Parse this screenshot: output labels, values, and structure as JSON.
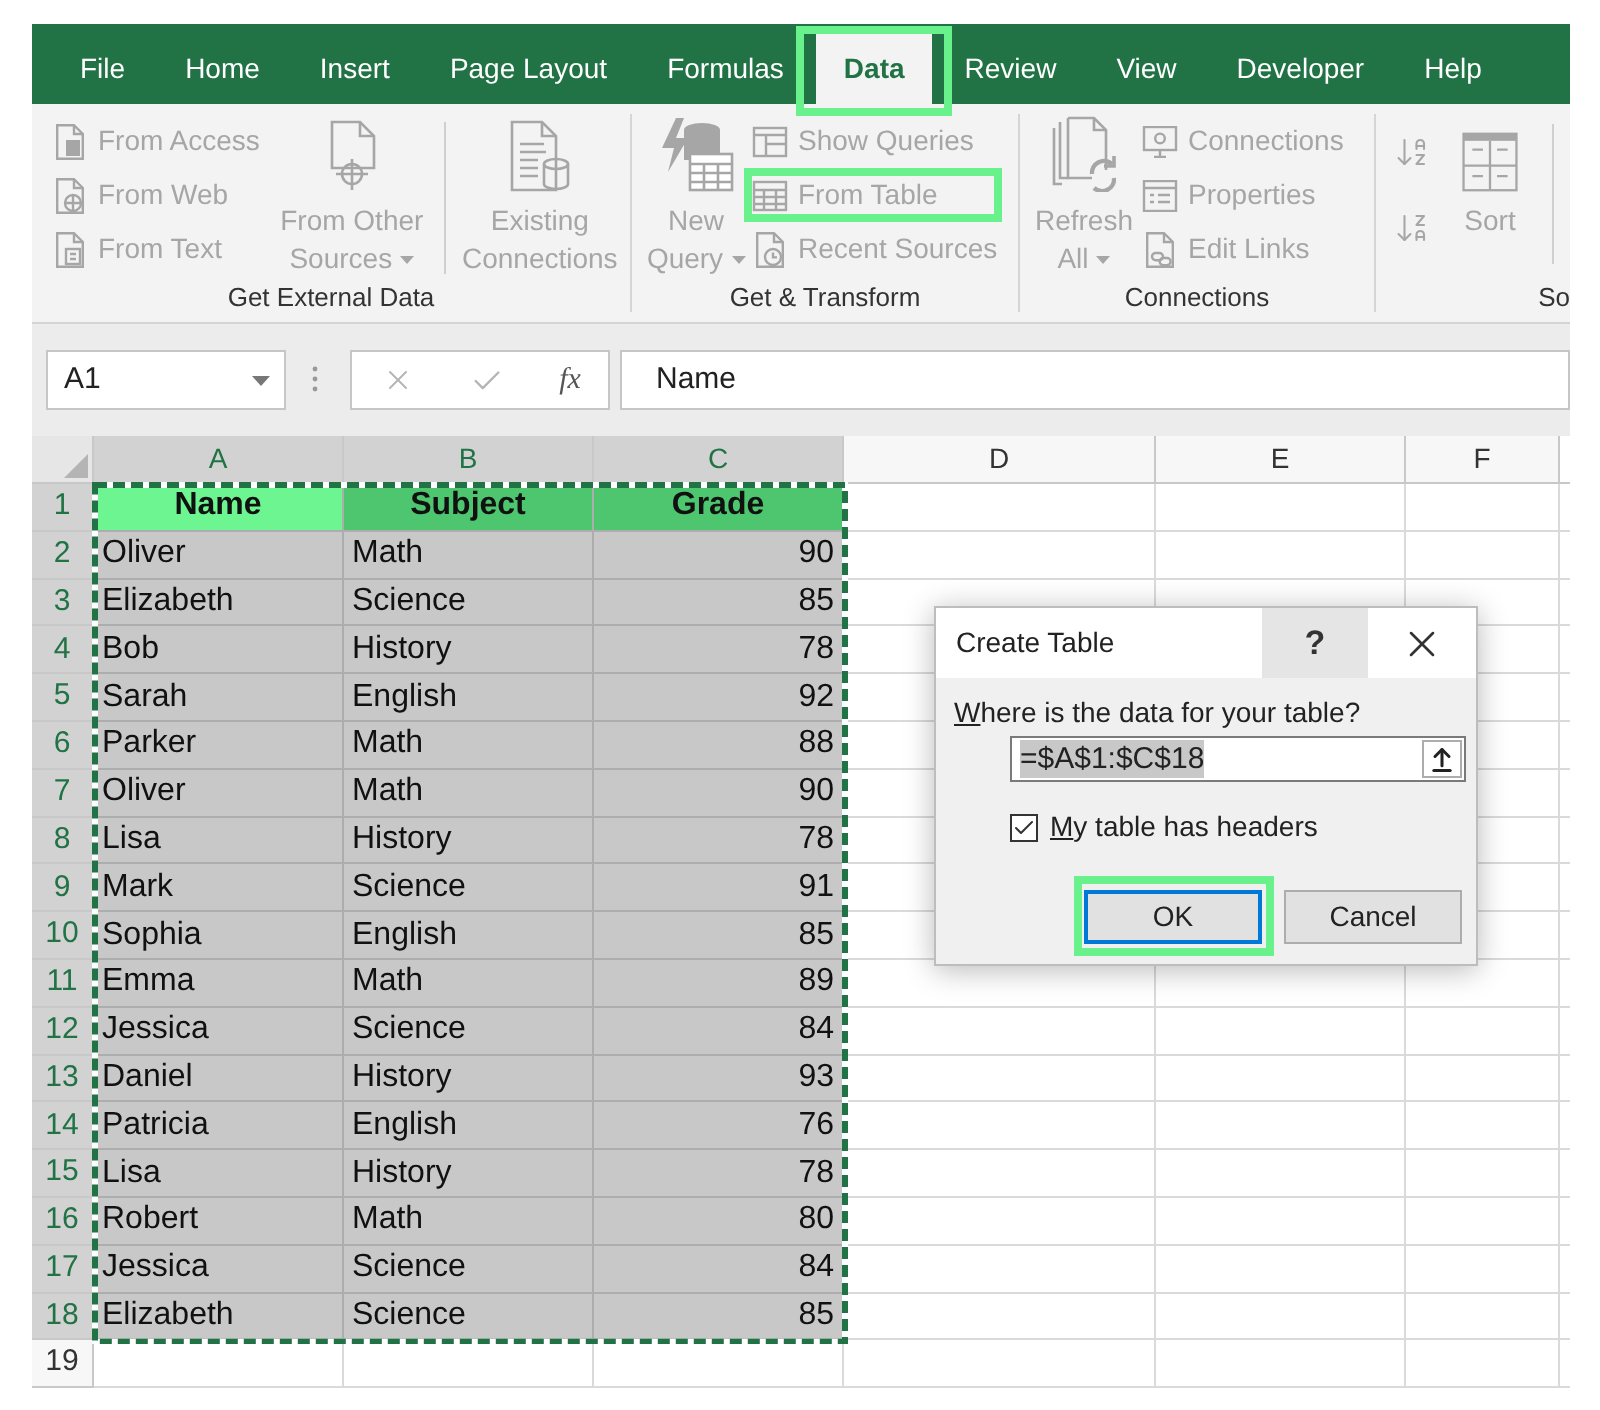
{
  "ribbon_tabs": [
    {
      "label": "File",
      "selected": false,
      "highlighted": false
    },
    {
      "label": "Home",
      "selected": false,
      "highlighted": false
    },
    {
      "label": "Insert",
      "selected": false,
      "highlighted": false
    },
    {
      "label": "Page Layout",
      "selected": false,
      "highlighted": false
    },
    {
      "label": "Formulas",
      "selected": false,
      "highlighted": false
    },
    {
      "label": "Data",
      "selected": true,
      "highlighted": true
    },
    {
      "label": "Review",
      "selected": false,
      "highlighted": false
    },
    {
      "label": "View",
      "selected": false,
      "highlighted": false
    },
    {
      "label": "Developer",
      "selected": false,
      "highlighted": false
    },
    {
      "label": "Help",
      "selected": false,
      "highlighted": false
    }
  ],
  "ribbon_groups": [
    {
      "label": "Get External Data",
      "label_clipped": false,
      "items": [
        {
          "kind": "stack",
          "buttons": [
            {
              "label": "From Access",
              "disabled": true,
              "highlighted": false
            },
            {
              "label": "From Web",
              "disabled": true,
              "highlighted": false
            },
            {
              "label": "From Text",
              "disabled": true,
              "highlighted": false
            }
          ]
        },
        {
          "kind": "large",
          "label": "From Other Sources",
          "dropdown": true,
          "disabled": true,
          "divider_before": false,
          "divider_after": false
        },
        {
          "kind": "large",
          "label": "Existing Connections",
          "dropdown": false,
          "disabled": true,
          "divider_before": true,
          "divider_after": false
        }
      ]
    },
    {
      "label": "Get & Transform",
      "label_clipped": false,
      "items": [
        {
          "kind": "large",
          "label": "New Query",
          "dropdown": true,
          "disabled": true,
          "divider_before": false,
          "divider_after": false
        },
        {
          "kind": "stack",
          "buttons": [
            {
              "label": "Show Queries",
              "disabled": true,
              "highlighted": false
            },
            {
              "label": "From Table",
              "disabled": true,
              "highlighted": true
            },
            {
              "label": "Recent Sources",
              "disabled": true,
              "highlighted": false
            }
          ]
        }
      ]
    },
    {
      "label": "Connections",
      "label_clipped": false,
      "items": [
        {
          "kind": "large",
          "label": "Refresh All",
          "dropdown": true,
          "disabled": true,
          "divider_before": false,
          "divider_after": false
        },
        {
          "kind": "stack",
          "buttons": [
            {
              "label": "Connections",
              "disabled": true,
              "highlighted": false
            },
            {
              "label": "Properties",
              "disabled": true,
              "highlighted": false
            },
            {
              "label": "Edit Links",
              "disabled": true,
              "highlighted": false
            }
          ]
        }
      ]
    },
    {
      "label": "So",
      "label_clipped": true,
      "items": [
        {
          "kind": "sort_pair",
          "buttons": [
            {
              "disabled": true
            },
            {
              "disabled": true
            }
          ]
        },
        {
          "kind": "large",
          "label": "Sort",
          "dropdown": false,
          "disabled": true,
          "divider_before": false,
          "divider_after": true
        }
      ]
    }
  ],
  "name_box": {
    "value": "A1"
  },
  "formula_bar": {
    "function_button": "fx",
    "value": "Name"
  },
  "sheet": {
    "columns": [
      {
        "letter": "A",
        "selected": true,
        "right_aligned": false
      },
      {
        "letter": "B",
        "selected": true,
        "right_aligned": false
      },
      {
        "letter": "C",
        "selected": true,
        "right_aligned": true
      },
      {
        "letter": "D",
        "selected": false
      },
      {
        "letter": "E",
        "selected": false
      },
      {
        "letter": "F",
        "selected": false
      }
    ],
    "rows": [
      {
        "number": "1",
        "selected": true,
        "kind": "header",
        "cells": [
          {
            "text": "Name",
            "active": true
          },
          {
            "text": "Subject",
            "active": false
          },
          {
            "text": "Grade",
            "active": false
          }
        ]
      },
      {
        "number": "2",
        "selected": true,
        "kind": "data",
        "cells": [
          {
            "text": "Oliver",
            "active": false
          },
          {
            "text": "Math",
            "active": false
          },
          {
            "text": "90",
            "active": false
          }
        ]
      },
      {
        "number": "3",
        "selected": true,
        "kind": "data",
        "cells": [
          {
            "text": "Elizabeth",
            "active": false
          },
          {
            "text": "Science",
            "active": false
          },
          {
            "text": "85",
            "active": false
          }
        ]
      },
      {
        "number": "4",
        "selected": true,
        "kind": "data",
        "cells": [
          {
            "text": "Bob",
            "active": false
          },
          {
            "text": "History",
            "active": false
          },
          {
            "text": "78",
            "active": false
          }
        ]
      },
      {
        "number": "5",
        "selected": true,
        "kind": "data",
        "cells": [
          {
            "text": "Sarah",
            "active": false
          },
          {
            "text": "English",
            "active": false
          },
          {
            "text": "92",
            "active": false
          }
        ]
      },
      {
        "number": "6",
        "selected": true,
        "kind": "data",
        "cells": [
          {
            "text": "Parker",
            "active": false
          },
          {
            "text": "Math",
            "active": false
          },
          {
            "text": "88",
            "active": false
          }
        ]
      },
      {
        "number": "7",
        "selected": true,
        "kind": "data",
        "cells": [
          {
            "text": "Oliver",
            "active": false
          },
          {
            "text": "Math",
            "active": false
          },
          {
            "text": "90",
            "active": false
          }
        ]
      },
      {
        "number": "8",
        "selected": true,
        "kind": "data",
        "cells": [
          {
            "text": "Lisa",
            "active": false
          },
          {
            "text": "History",
            "active": false
          },
          {
            "text": "78",
            "active": false
          }
        ]
      },
      {
        "number": "9",
        "selected": true,
        "kind": "data",
        "cells": [
          {
            "text": "Mark",
            "active": false
          },
          {
            "text": "Science",
            "active": false
          },
          {
            "text": "91",
            "active": false
          }
        ]
      },
      {
        "number": "10",
        "selected": true,
        "kind": "data",
        "cells": [
          {
            "text": "Sophia",
            "active": false
          },
          {
            "text": "English",
            "active": false
          },
          {
            "text": "85",
            "active": false
          }
        ]
      },
      {
        "number": "11",
        "selected": true,
        "kind": "data",
        "cells": [
          {
            "text": "Emma",
            "active": false
          },
          {
            "text": "Math",
            "active": false
          },
          {
            "text": "89",
            "active": false
          }
        ]
      },
      {
        "number": "12",
        "selected": true,
        "kind": "data",
        "cells": [
          {
            "text": "Jessica",
            "active": false
          },
          {
            "text": "Science",
            "active": false
          },
          {
            "text": "84",
            "active": false
          }
        ]
      },
      {
        "number": "13",
        "selected": true,
        "kind": "data",
        "cells": [
          {
            "text": "Daniel",
            "active": false
          },
          {
            "text": "History",
            "active": false
          },
          {
            "text": "93",
            "active": false
          }
        ]
      },
      {
        "number": "14",
        "selected": true,
        "kind": "data",
        "cells": [
          {
            "text": "Patricia",
            "active": false
          },
          {
            "text": "English",
            "active": false
          },
          {
            "text": "76",
            "active": false
          }
        ]
      },
      {
        "number": "15",
        "selected": true,
        "kind": "data",
        "cells": [
          {
            "text": "Lisa",
            "active": false
          },
          {
            "text": "History",
            "active": false
          },
          {
            "text": "78",
            "active": false
          }
        ]
      },
      {
        "number": "16",
        "selected": true,
        "kind": "data",
        "cells": [
          {
            "text": "Robert",
            "active": false
          },
          {
            "text": "Math",
            "active": false
          },
          {
            "text": "80",
            "active": false
          }
        ]
      },
      {
        "number": "17",
        "selected": true,
        "kind": "data",
        "cells": [
          {
            "text": "Jessica",
            "active": false
          },
          {
            "text": "Science",
            "active": false
          },
          {
            "text": "84",
            "active": false
          }
        ]
      },
      {
        "number": "18",
        "selected": true,
        "kind": "data",
        "cells": [
          {
            "text": "Elizabeth",
            "active": false
          },
          {
            "text": "Science",
            "active": false
          },
          {
            "text": "85",
            "active": false
          }
        ]
      },
      {
        "number": "19",
        "selected": false,
        "kind": "data",
        "cells": []
      }
    ]
  },
  "dialog": {
    "title": "Create Table",
    "help_button": "?",
    "prompt": "Where is the data for your table?",
    "prompt_mnemonic": true,
    "range_field": {
      "value": "=$A$1:$C$18",
      "text_selected": true
    },
    "checkbox": {
      "label": "My table has headers",
      "checked": true,
      "mnemonic": true
    },
    "buttons": [
      {
        "label": "OK",
        "kind": "default",
        "highlighted": true
      },
      {
        "label": "Cancel",
        "kind": "normal",
        "highlighted": false
      }
    ]
  }
}
